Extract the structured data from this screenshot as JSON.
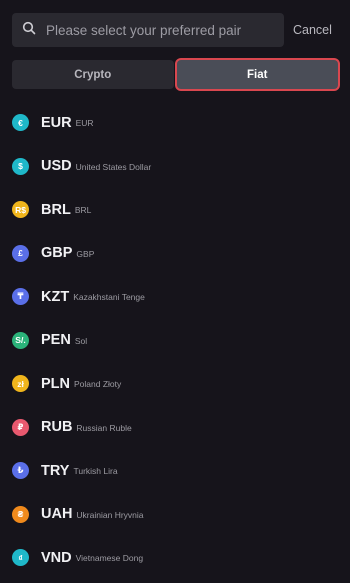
{
  "search": {
    "placeholder": "Please select your preferred pair",
    "value": "",
    "icon": "search-icon"
  },
  "cancel_label": "Cancel",
  "tabs": [
    {
      "label": "Crypto",
      "active": false
    },
    {
      "label": "Fiat",
      "active": true
    }
  ],
  "currencies": [
    {
      "code": "EUR",
      "name": "EUR",
      "symbol": "€",
      "color": "#1fb8c9"
    },
    {
      "code": "USD",
      "name": "United States Dollar",
      "symbol": "$",
      "color": "#1fb8c9"
    },
    {
      "code": "BRL",
      "name": "BRL",
      "symbol": "R$",
      "color": "#f0b51c"
    },
    {
      "code": "GBP",
      "name": "GBP",
      "symbol": "£",
      "color": "#5a6fe8"
    },
    {
      "code": "KZT",
      "name": "Kazakhstani Tenge",
      "symbol": "₸",
      "color": "#5a6fe8"
    },
    {
      "code": "PEN",
      "name": "Sol",
      "symbol": "S/.",
      "color": "#2bb37a"
    },
    {
      "code": "PLN",
      "name": "Poland Złoty",
      "symbol": "zł",
      "color": "#f0b51c"
    },
    {
      "code": "RUB",
      "name": "Russian Ruble",
      "symbol": "₽",
      "color": "#e8596f"
    },
    {
      "code": "TRY",
      "name": "Turkish Lira",
      "symbol": "₺",
      "color": "#5a6fe8"
    },
    {
      "code": "UAH",
      "name": "Ukrainian Hryvnia",
      "symbol": "₴",
      "color": "#f08a1c"
    },
    {
      "code": "VND",
      "name": "Vietnamese Dong",
      "symbol": "₫",
      "color": "#1fb8c9"
    }
  ]
}
